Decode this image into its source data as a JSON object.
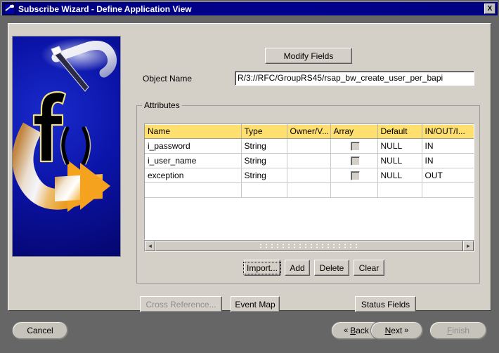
{
  "window": {
    "title": "Subscribe Wizard - Define Application View",
    "close_label": "X",
    "icon": "wand-icon",
    "titlebar_color": "#000080",
    "panel_color": "#d4d0c8",
    "frame_color": "#666666"
  },
  "banner": {
    "name": "wizard-banner-graphic",
    "background_color": "#0b14a8",
    "accent_color": "#f5a21e",
    "glyph": "f()"
  },
  "toolbar": {
    "modify_fields_label": "Modify Fields"
  },
  "object": {
    "label": "Object Name",
    "value": "R/3://RFC/GroupRS45/rsap_bw_create_user_per_bapi",
    "placeholder": ""
  },
  "attributes": {
    "group_title": "Attributes",
    "columns": [
      "Name",
      "Type",
      "Owner/V...",
      "Array",
      "Default",
      "IN/OUT/I..."
    ],
    "rows": [
      {
        "name": "i_password",
        "type": "String",
        "owner": "",
        "array": false,
        "default": "NULL",
        "direction": "IN"
      },
      {
        "name": "i_user_name",
        "type": "String",
        "owner": "",
        "array": false,
        "default": "NULL",
        "direction": "IN"
      },
      {
        "name": "exception",
        "type": "String",
        "owner": "",
        "array": false,
        "default": "NULL",
        "direction": "OUT"
      }
    ],
    "header_color": "#ffdf6e",
    "buttons": {
      "import_label": "Import...",
      "add_label": "Add",
      "delete_label": "Delete",
      "clear_label": "Clear"
    },
    "scrollbar": {
      "left_arrow": "◄",
      "right_arrow": "►"
    }
  },
  "secondary": {
    "cross_reference_label": "Cross Reference...",
    "cross_reference_enabled": false,
    "event_map_label": "Event Map",
    "status_fields_label": "Status Fields"
  },
  "nav": {
    "cancel_label": "Cancel",
    "back_label": "Back",
    "back_mnemonic": "B",
    "back_arrow": "«",
    "next_label": "Next",
    "next_mnemonic": "N",
    "next_arrow": "»",
    "finish_label": "Finish",
    "finish_mnemonic": "F",
    "finish_enabled": false
  }
}
